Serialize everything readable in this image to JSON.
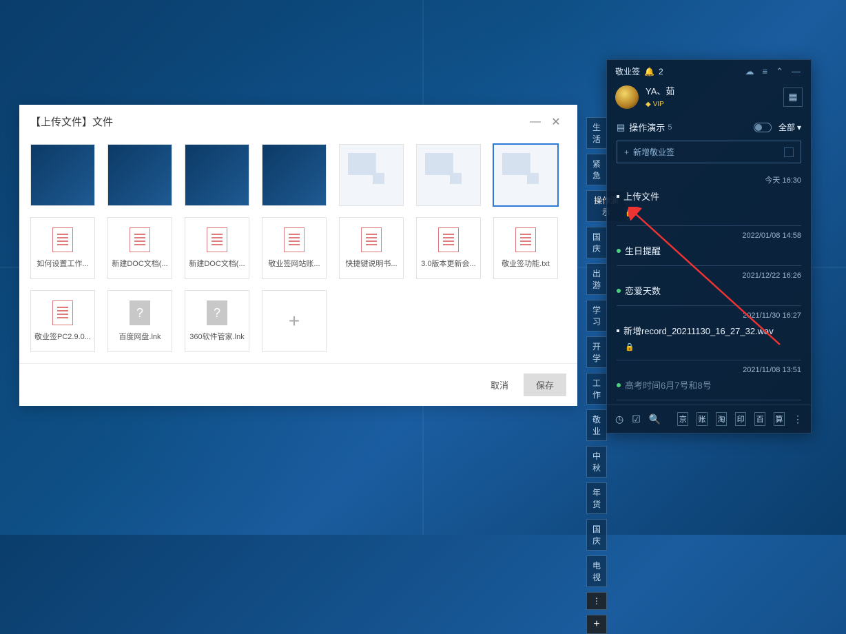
{
  "dialog": {
    "title": "【上传文件】文件",
    "cancel": "取消",
    "save": "保存",
    "files_row2": [
      "如何设置工作...",
      "新建DOC文档(...",
      "新建DOC文档(...",
      "敬业签网站账...",
      "快捷键说明书...",
      "3.0版本更新会...",
      "敬业签功能.txt"
    ],
    "files_row3": [
      "敬业签PC2.9.0...",
      "百度网盘.lnk",
      "360软件管家.lnk"
    ]
  },
  "tags": [
    "生活",
    "紧急",
    "操作演示",
    "国庆",
    "出游",
    "学习",
    "开学",
    "工作",
    "敬业",
    "中秋",
    "年货",
    "国庆",
    "电视"
  ],
  "panel": {
    "app_name": "敬业签",
    "bell_count": "2",
    "user_name": "YA、茹",
    "vip": "VIP",
    "category": "操作演示",
    "cat_count": "5",
    "filter": "全部",
    "add_label": "新增敬业签",
    "notes": [
      {
        "time": "今天 16:30",
        "title": "上传文件",
        "type": "plain",
        "has_lock": true
      },
      {
        "time": "2022/01/08 14:58",
        "title": "生日提醒",
        "type": "green"
      },
      {
        "time": "2021/12/22 16:26",
        "title": "恋爱天数",
        "type": "green"
      },
      {
        "time": "2021/11/30 16:27",
        "title": "新增record_20211130_16_27_32.wav",
        "type": "plain",
        "has_lock": true
      },
      {
        "time": "2021/11/08 13:51",
        "title": "高考时间6月7号和8号",
        "type": "green-muted"
      }
    ],
    "foot_sq": [
      "京",
      "账",
      "淘",
      "印",
      "百",
      "算"
    ]
  }
}
